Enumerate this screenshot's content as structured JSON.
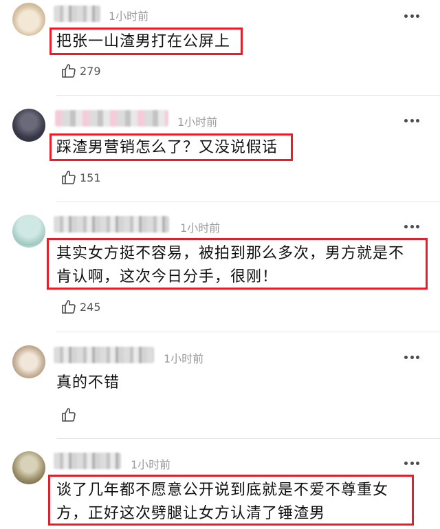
{
  "comments": [
    {
      "time": "1小时前",
      "text": "把张一山渣男打在公屏上",
      "likes": "279",
      "highlighted": true
    },
    {
      "time": "1小时前",
      "text": "踩渣男营销怎么了？又没说假话",
      "likes": "151",
      "highlighted": true
    },
    {
      "time": "1小时前",
      "lines": [
        "其实女方挺不容易，被拍到那么多次，男方就是不",
        "肯认啊，这次今日分手，很刚！"
      ],
      "likes": "245",
      "highlighted": true
    },
    {
      "time": "1小时前",
      "text": "真的不错",
      "likes": "",
      "highlighted": false
    },
    {
      "time": "1小时前",
      "lines": [
        "谈了几年都不愿意公开说到底就是不爱不尊重女",
        "方，正好这次劈腿让女方认清了锤渣男"
      ],
      "highlighted": true
    }
  ],
  "icons": {
    "like": "thumbs-up-icon",
    "more": "more-dots-icon"
  },
  "colors": {
    "highlight": "#e21f2b",
    "meta": "#9a9a9a",
    "text": "#111111"
  }
}
